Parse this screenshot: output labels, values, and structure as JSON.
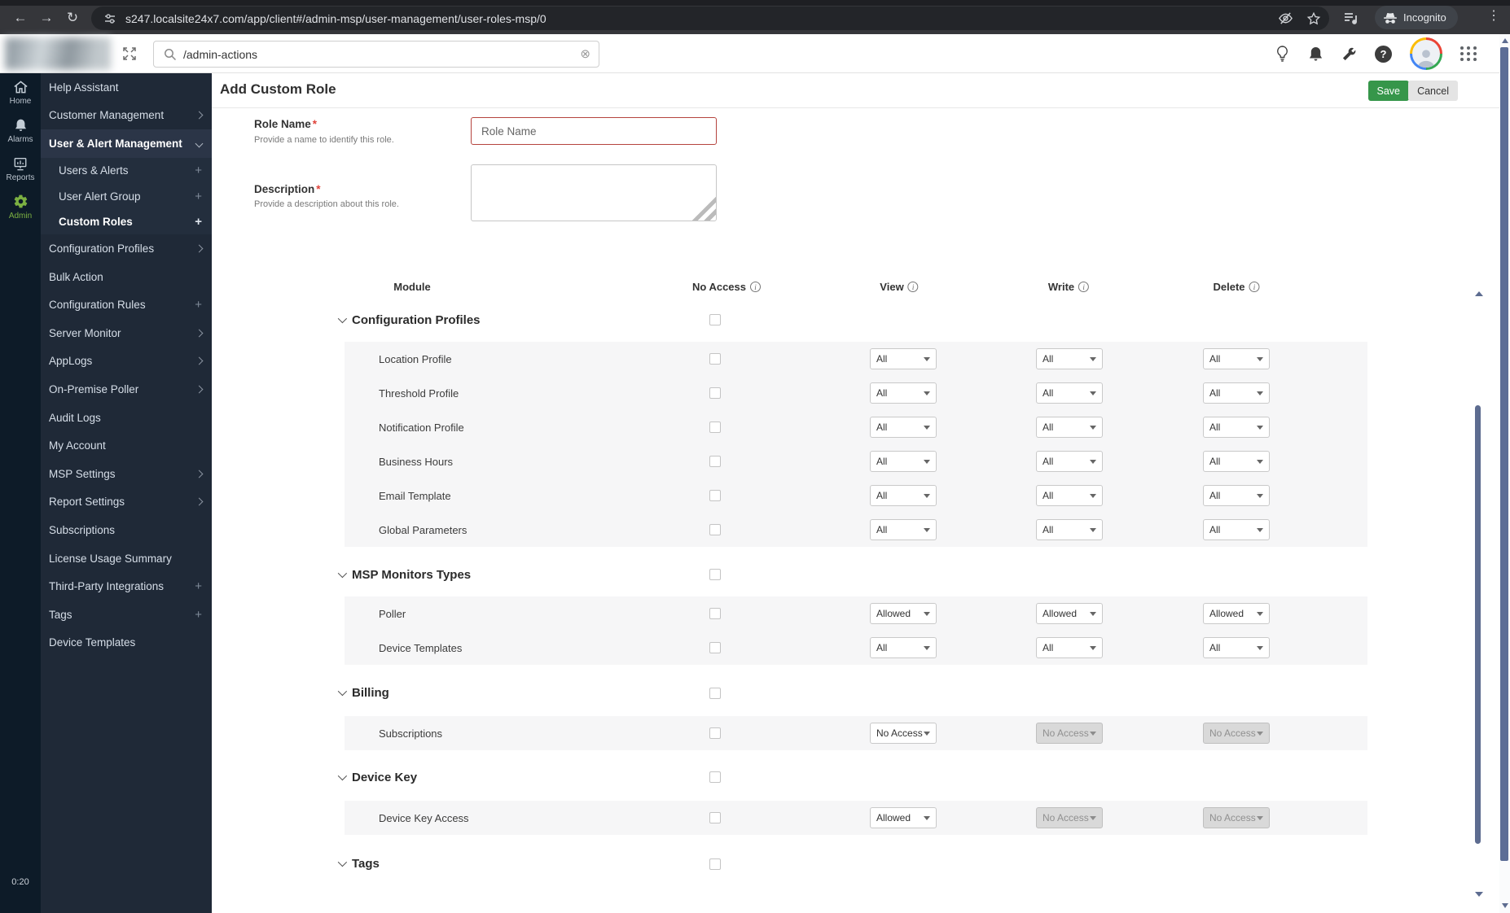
{
  "browser": {
    "url": "s247.localsite24x7.com/app/client#/admin-msp/user-management/user-roles-msp/0",
    "incognito_label": "Incognito",
    "icons": {
      "back": "←",
      "forward": "→",
      "reload": "↻",
      "more": "⋮"
    }
  },
  "appbar": {
    "search_value": "/admin-actions",
    "clear_glyph": "⊗",
    "help_glyph": "?"
  },
  "rail": {
    "items": [
      {
        "label": "Home"
      },
      {
        "label": "Alarms"
      },
      {
        "label": "Reports"
      },
      {
        "label": "Admin"
      }
    ],
    "timer": "0:20"
  },
  "sidebar": {
    "items": [
      {
        "label": "Help Assistant",
        "affix": "none"
      },
      {
        "label": "Customer Management",
        "affix": "chevron-right"
      },
      {
        "label": "User & Alert Management",
        "affix": "chevron-down"
      },
      {
        "label": "Users & Alerts",
        "affix": "plus"
      },
      {
        "label": "User Alert Group",
        "affix": "plus"
      },
      {
        "label": "Custom Roles",
        "affix": "plus"
      },
      {
        "label": "Configuration Profiles",
        "affix": "chevron-right"
      },
      {
        "label": "Bulk Action",
        "affix": "none"
      },
      {
        "label": "Configuration Rules",
        "affix": "plus"
      },
      {
        "label": "Server Monitor",
        "affix": "chevron-right"
      },
      {
        "label": "AppLogs",
        "affix": "chevron-right"
      },
      {
        "label": "On-Premise Poller",
        "affix": "chevron-right"
      },
      {
        "label": "Audit Logs",
        "affix": "none"
      },
      {
        "label": "My Account",
        "affix": "none"
      },
      {
        "label": "MSP Settings",
        "affix": "chevron-right"
      },
      {
        "label": "Report Settings",
        "affix": "chevron-right"
      },
      {
        "label": "Subscriptions",
        "affix": "none"
      },
      {
        "label": "License Usage Summary",
        "affix": "none"
      },
      {
        "label": "Third-Party Integrations",
        "affix": "plus"
      },
      {
        "label": "Tags",
        "affix": "plus"
      },
      {
        "label": "Device Templates",
        "affix": "none"
      }
    ],
    "plus_glyph": "+"
  },
  "header": {
    "title": "Add Custom Role",
    "save_label": "Save",
    "cancel_label": "Cancel"
  },
  "form": {
    "role_name": {
      "label": "Role Name",
      "required_mark": "*",
      "help": "Provide a name to identify this role.",
      "placeholder": "Role Name",
      "value": ""
    },
    "description": {
      "label": "Description",
      "required_mark": "*",
      "help": "Provide a description about this role.",
      "value": ""
    }
  },
  "table": {
    "header": {
      "module": "Module",
      "no_access": "No Access",
      "view": "View",
      "write": "Write",
      "delete": "Delete"
    },
    "sections": [
      {
        "title": "Configuration Profiles",
        "checkbox_checked": false,
        "rows": [
          {
            "label": "Location Profile",
            "checkbox_checked": false,
            "view": "All",
            "write": "All",
            "delete": "All",
            "view_enabled": true,
            "write_enabled": true,
            "delete_enabled": true
          },
          {
            "label": "Threshold Profile",
            "checkbox_checked": false,
            "view": "All",
            "write": "All",
            "delete": "All",
            "view_enabled": true,
            "write_enabled": true,
            "delete_enabled": true
          },
          {
            "label": "Notification Profile",
            "checkbox_checked": false,
            "view": "All",
            "write": "All",
            "delete": "All",
            "view_enabled": true,
            "write_enabled": true,
            "delete_enabled": true
          },
          {
            "label": "Business Hours",
            "checkbox_checked": false,
            "view": "All",
            "write": "All",
            "delete": "All",
            "view_enabled": true,
            "write_enabled": true,
            "delete_enabled": true
          },
          {
            "label": "Email Template",
            "checkbox_checked": false,
            "view": "All",
            "write": "All",
            "delete": "All",
            "view_enabled": true,
            "write_enabled": true,
            "delete_enabled": true
          },
          {
            "label": "Global Parameters",
            "checkbox_checked": false,
            "view": "All",
            "write": "All",
            "delete": "All",
            "view_enabled": true,
            "write_enabled": true,
            "delete_enabled": true
          }
        ]
      },
      {
        "title": "MSP Monitors Types",
        "checkbox_checked": false,
        "rows": [
          {
            "label": "Poller",
            "checkbox_checked": false,
            "view": "Allowed",
            "write": "Allowed",
            "delete": "Allowed",
            "view_enabled": true,
            "write_enabled": true,
            "delete_enabled": true
          },
          {
            "label": "Device Templates",
            "checkbox_checked": false,
            "view": "All",
            "write": "All",
            "delete": "All",
            "view_enabled": true,
            "write_enabled": true,
            "delete_enabled": true
          }
        ]
      },
      {
        "title": "Billing",
        "checkbox_checked": false,
        "rows": [
          {
            "label": "Subscriptions",
            "checkbox_checked": false,
            "view": "No Access",
            "write": "No Access",
            "delete": "No Access",
            "view_enabled": true,
            "write_enabled": false,
            "delete_enabled": false
          }
        ]
      },
      {
        "title": "Device Key",
        "checkbox_checked": false,
        "rows": [
          {
            "label": "Device Key Access",
            "checkbox_checked": false,
            "view": "Allowed",
            "write": "No Access",
            "delete": "No Access",
            "view_enabled": true,
            "write_enabled": false,
            "delete_enabled": false
          }
        ]
      },
      {
        "title": "Tags",
        "checkbox_checked": false,
        "rows": []
      }
    ]
  },
  "colors": {
    "save_green": "#36964a",
    "error_red": "#b5443e",
    "admin_green": "#7cb142",
    "scrollbar_slate": "#5d6c90"
  }
}
